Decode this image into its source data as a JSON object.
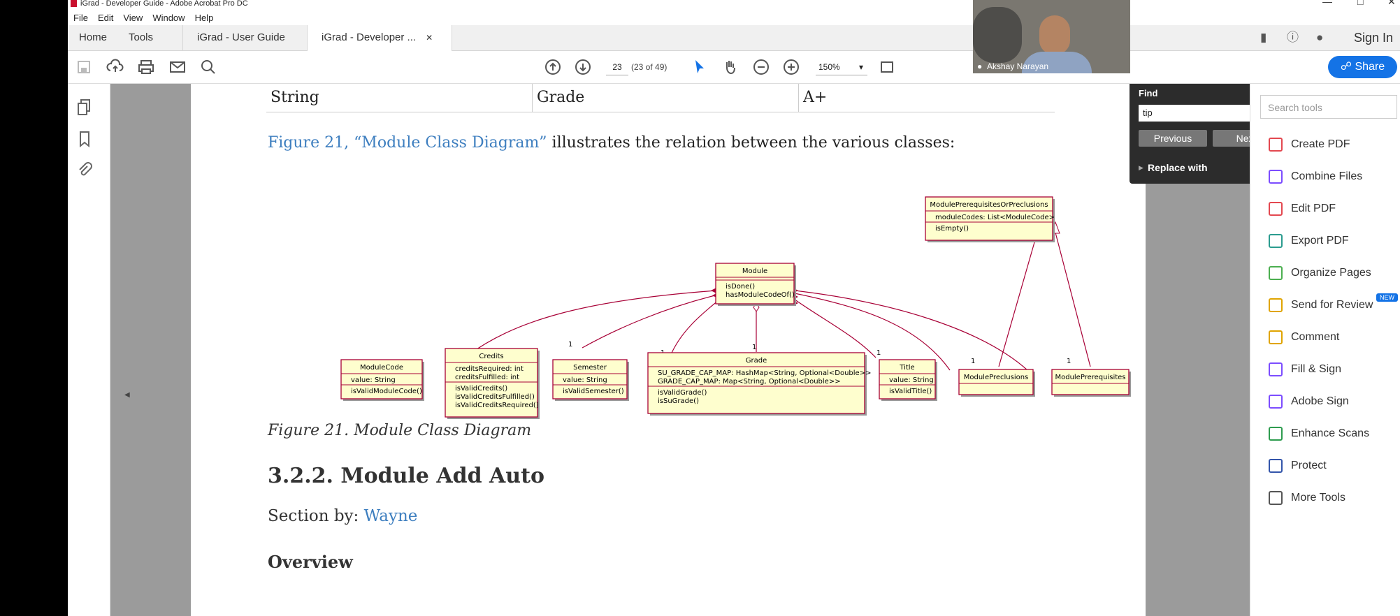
{
  "window": {
    "title": "iGrad - Developer Guide - Adobe Acrobat Pro DC"
  },
  "menu": [
    "File",
    "Edit",
    "View",
    "Window",
    "Help"
  ],
  "tabs": {
    "home": "Home",
    "tools": "Tools",
    "doc1": "iGrad - User Guide",
    "doc2": "iGrad - Developer ..."
  },
  "topright": {
    "signin": "Sign In"
  },
  "toolbar": {
    "page_current": "23",
    "page_total": "(23 of 49)",
    "zoom": "150%"
  },
  "share": "Share",
  "video": {
    "name": "Akshay Narayan"
  },
  "find": {
    "title": "Find",
    "query": "tip",
    "prev": "Previous",
    "next": "Next",
    "replace": "Replace with"
  },
  "tools_panel": {
    "search_placeholder": "Search tools",
    "items": [
      "Create PDF",
      "Combine Files",
      "Edit PDF",
      "Export PDF",
      "Organize Pages",
      "Send for Review",
      "Comment",
      "Fill & Sign",
      "Adobe Sign",
      "Enhance Scans",
      "Protect",
      "More Tools"
    ],
    "new_badge": "NEW"
  },
  "document": {
    "table_row": [
      "String",
      "Grade",
      "A+"
    ],
    "fig_ref": "Figure 21, “Module Class Diagram”",
    "fig_ref_rest": " illustrates the relation between the various classes:",
    "caption": "Figure 21. Module Class Diagram",
    "heading": "3.2.2. Module Add Auto",
    "section_by_label": "Section by: ",
    "section_by_name": "Wayne",
    "overview": "Overview"
  },
  "diagram": {
    "classes": [
      {
        "name": "ModulePrerequisitesOrPreclusions",
        "attrs": [
          "moduleCodes: List<ModuleCode>"
        ],
        "methods": [
          "isEmpty()"
        ]
      },
      {
        "name": "Module",
        "attrs": [],
        "methods": [
          "isDone()",
          "hasModuleCodeOf()"
        ]
      },
      {
        "name": "ModuleCode",
        "attrs": [
          "value: String"
        ],
        "methods": [
          "isValidModuleCode()"
        ]
      },
      {
        "name": "Credits",
        "attrs": [
          "creditsRequired: int",
          "creditsFulfilled: int"
        ],
        "methods": [
          "isValidCredits()",
          "isValidCreditsFulfilled()",
          "isValidCreditsRequired()"
        ]
      },
      {
        "name": "Semester",
        "attrs": [
          "value: String"
        ],
        "methods": [
          "isValidSemester()"
        ]
      },
      {
        "name": "Grade",
        "attrs": [
          "SU_GRADE_CAP_MAP: HashMap<String, Optional<Double>>",
          "GRADE_CAP_MAP: Map<String, Optional<Double>>"
        ],
        "methods": [
          "isValidGrade()",
          "isSuGrade()"
        ]
      },
      {
        "name": "Title",
        "attrs": [
          "value: String"
        ],
        "methods": [
          "isValidTitle()"
        ]
      },
      {
        "name": "ModulePreclusions",
        "attrs": [],
        "methods": []
      },
      {
        "name": "ModulePrerequisites",
        "attrs": [],
        "methods": []
      }
    ],
    "multiplicity": "1"
  },
  "colors": {
    "accent": "#1473e6",
    "link": "#3d7ebf",
    "uml_fill": "#fefece",
    "uml_border": "#a80036"
  }
}
